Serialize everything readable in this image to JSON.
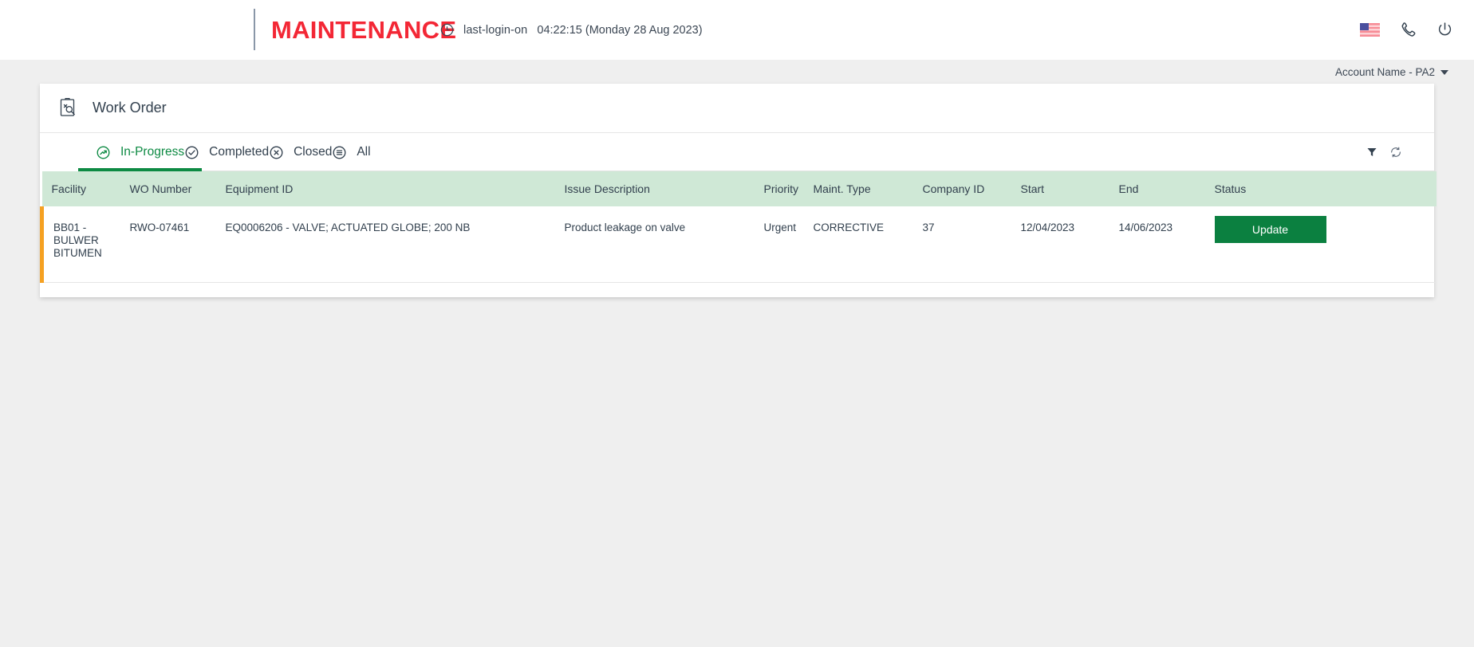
{
  "header": {
    "brand": "MAINTENANCE",
    "clock_icon": "clock-icon",
    "last_login_label": "last-login-on",
    "last_login_value": "04:22:15 (Monday 28 Aug 2023)",
    "flag_icon": "us-flag-icon",
    "phone_icon": "phone-icon",
    "power_icon": "power-icon"
  },
  "account_bar": {
    "account_label": "Account Name - PA2",
    "chevron_icon": "chevron-down-icon"
  },
  "card": {
    "title": "Work Order",
    "title_icon": "work-order-inspection-icon"
  },
  "tabs": [
    {
      "label": "In-Progress",
      "icon": "trend-up-circle-icon",
      "active": true
    },
    {
      "label": "Completed",
      "icon": "check-circle-icon",
      "active": false
    },
    {
      "label": "Closed",
      "icon": "close-circle-icon",
      "active": false
    },
    {
      "label": "All",
      "icon": "list-circle-icon",
      "active": false
    }
  ],
  "tab_tools": {
    "filter_icon": "filter-icon",
    "refresh_icon": "refresh-icon"
  },
  "table": {
    "columns": [
      "Facility",
      "WO Number",
      "Equipment ID",
      "Issue Description",
      "Priority",
      "Maint. Type",
      "Company ID",
      "Start",
      "End",
      "Status"
    ],
    "rows": [
      {
        "facility": "BB01 - BULWER BITUMEN",
        "wo_number": "RWO-07461",
        "equipment_id": "EQ0006206 - VALVE; ACTUATED GLOBE; 200 NB",
        "issue_description": "Product leakage on valve",
        "priority": "Urgent",
        "maint_type": "CORRECTIVE",
        "company_id": "37",
        "start": "12/04/2023",
        "end": "14/06/2023",
        "status_action": "Update"
      }
    ]
  },
  "colors": {
    "brand_red": "#f32735",
    "accent_green": "#0d8a43",
    "button_green": "#0b8040",
    "table_header_green": "#cfe8d6",
    "row_marker_orange": "#f5a122",
    "page_background": "#efefef",
    "text_dark": "#32404e"
  }
}
